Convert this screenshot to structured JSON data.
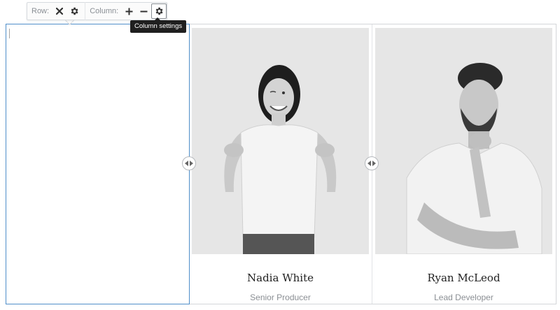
{
  "toolbar": {
    "row_label": "Row:",
    "column_label": "Column:",
    "buttons": {
      "row_remove": "close-icon",
      "row_settings": "gear-icon",
      "column_add": "plus-icon",
      "column_remove": "minus-icon",
      "column_settings": "gear-icon"
    }
  },
  "tooltip": {
    "text": "Column settings"
  },
  "columns": [
    {
      "type": "empty"
    },
    {
      "type": "profile",
      "name": "Nadia White",
      "role": "Senior Producer"
    },
    {
      "type": "profile",
      "name": "Ryan McLeod",
      "role": "Lead Developer"
    }
  ],
  "colors": {
    "selected_column_border": "#4f8ec9",
    "tooltip_bg": "#1f1f1f",
    "photo_bg": "#e8e8e8"
  }
}
